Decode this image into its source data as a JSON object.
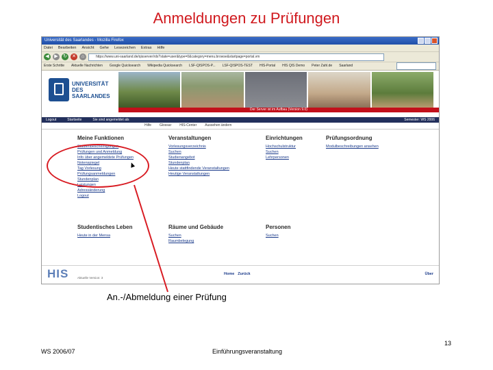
{
  "slide": {
    "title": "Anmeldungen zu Prüfungen",
    "caption": "An.-/Abmeldung einer Prüfung",
    "page_number": "13",
    "footer_left": "WS 2006/07",
    "footer_center": "Einführungsveranstaltung"
  },
  "browser": {
    "window_title": "Universität des Saarlandes - Mozilla Firefox",
    "menu": [
      "Datei",
      "Bearbeiten",
      "Ansicht",
      "Gehe",
      "Lesezeichen",
      "Extras",
      "Hilfe"
    ],
    "url": "https://www.uni-saarland.de/qisserver/rds?state=user&type=0&category=menu.browse&startpage=portal.vm",
    "bookmarks": [
      "Erste Schritte",
      "Aktuelle Nachrichten",
      "Google Quicksearch",
      "Wikipedia Quicksearch",
      "LSF-QISPOS-P...",
      "LSF-QISPOS-TEST",
      "HIS-Portal",
      "HIS QIS Demo",
      "Peter Zahl.de",
      "Saarland"
    ]
  },
  "portal": {
    "logo_lines": [
      "UNIVERSITÄT",
      "DES",
      "SAARLANDES"
    ],
    "server_notice": "Der Server ist im Aufbau (Version 9.0)",
    "nav_items": [
      "Logout",
      "Startseite",
      "Sie sind angemeldet als",
      "Hilfe",
      "Glossar",
      "HIS-Center"
    ],
    "nav_right": "Semester: WS 2006",
    "subnav_items": [
      "Hilfe",
      "Glossar",
      "HIS-Center",
      "Aussehen ändern"
    ],
    "columns": [
      {
        "heading": "Meine Funktionen",
        "links": [
          "Studienbescheinigungen",
          "Prüfungen und Anmeldung",
          "Info über angemeldete Prüfungen",
          "Notenspiegel",
          "Tag Vorlesung",
          "Prüfungsanmeldungen",
          "Stundenplan",
          "Leistungen",
          "Adressänderung",
          "Logout"
        ]
      },
      {
        "heading": "Veranstaltungen",
        "links": [
          "Vorlesungsverzeichnis",
          "Suchen",
          "Studienangebot",
          "Stundenplan",
          "Heute stattfindende Veranstaltungen",
          "Heutige Veranstaltungen"
        ]
      },
      {
        "heading": "Einrichtungen",
        "links": [
          "Hochschulstruktur",
          "Suchen",
          "Lehrpersonen"
        ]
      },
      {
        "heading": "Prüfungsordnung",
        "links": [
          "Modulbeschreibungen ansehen"
        ]
      },
      {
        "heading": "Studentisches Leben",
        "links": [
          "Heute in der Mensa"
        ]
      },
      {
        "heading": "Räume und Gebäude",
        "links": [
          "Suchen",
          "Raumbelegung"
        ]
      },
      {
        "heading": "Personen",
        "links": [
          "Suchen"
        ]
      }
    ],
    "his_logo": "HIS",
    "his_sub": "Aktuelle Version: 3",
    "footer_links": [
      "Home",
      "Zurück"
    ],
    "footer_right": "Über"
  },
  "colors": {
    "title_red": "#d0191e",
    "annotation_red": "#d81b22",
    "nav_dark": "#23305c",
    "server_bar_red": "#c2101b"
  }
}
